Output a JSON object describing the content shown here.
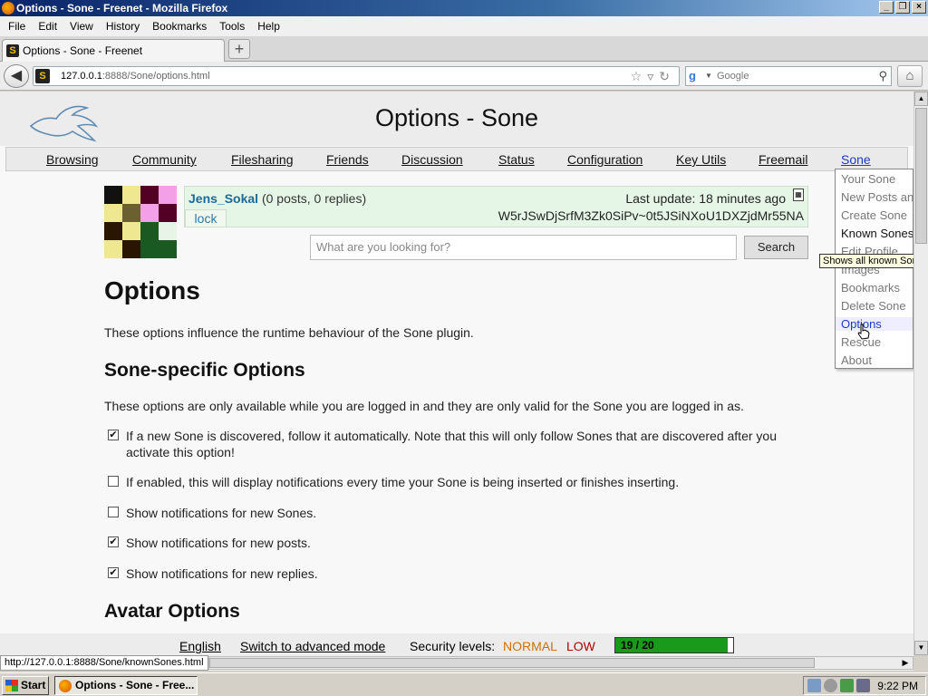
{
  "window": {
    "title": "Options - Sone - Freenet - Mozilla Firefox"
  },
  "menubar": [
    "File",
    "Edit",
    "View",
    "History",
    "Bookmarks",
    "Tools",
    "Help"
  ],
  "tab": {
    "title": "Options - Sone - Freenet",
    "new_tab": "+"
  },
  "urlbar": {
    "host": "127.0.0.1",
    "path": ":8888/Sone/options.html"
  },
  "searchbar": {
    "placeholder": "Google"
  },
  "page": {
    "heading": "Options - Sone",
    "nav": [
      "Browsing",
      "Community",
      "Filesharing",
      "Friends",
      "Discussion",
      "Status",
      "Configuration",
      "Key Utils",
      "Freemail",
      "Sone"
    ]
  },
  "sone": {
    "name": "Jens_Sokal",
    "stats": "(0 posts, 0 replies)",
    "last_update": "Last update: 18 minutes ago",
    "id": "W5rJSwDjSrfM3Zk0SiPv~0t5JSiNXoU1DXZjdMr55NA",
    "lock": "lock"
  },
  "search": {
    "placeholder": "What are you looking for?",
    "button": "Search"
  },
  "options": {
    "title": "Options",
    "intro": "These options influence the runtime behaviour of the Sone plugin.",
    "sone_specific_title": "Sone-specific Options",
    "sone_specific_intro": "These options are only available while you are logged in and they are only valid for the Sone you are logged in as.",
    "items": [
      {
        "checked": true,
        "text": "If a new Sone is discovered, follow it automatically. Note that this will only follow Sones that are discovered after you activate this option!"
      },
      {
        "checked": false,
        "text": "If enabled, this will display notifications every time your Sone is being inserted or finishes inserting."
      },
      {
        "checked": false,
        "text": "Show notifications for new Sones."
      },
      {
        "checked": true,
        "text": "Show notifications for new posts."
      },
      {
        "checked": true,
        "text": "Show notifications for new replies."
      }
    ],
    "avatar_title": "Avatar Options"
  },
  "dropdown": {
    "items": [
      "Your Sone",
      "New Posts an",
      "Create Sone",
      "Known Sones",
      "Edit Profile",
      "Images",
      "Bookmarks",
      "Delete Sone",
      "Options",
      "Rescue",
      "About"
    ],
    "tooltip": "Shows all known Sones"
  },
  "footer": {
    "language": "English",
    "advanced": "Switch to advanced mode",
    "security_label": "Security levels:",
    "security_network": "NORMAL",
    "security_friends": "LOW",
    "peers": "19 / 20",
    "peers_fraction": 0.95
  },
  "statusbar": {
    "url": "http://127.0.0.1:8888/Sone/knownSones.html"
  },
  "taskbar": {
    "start": "Start",
    "item": "Options - Sone - Free...",
    "clock": "9:22 PM"
  }
}
